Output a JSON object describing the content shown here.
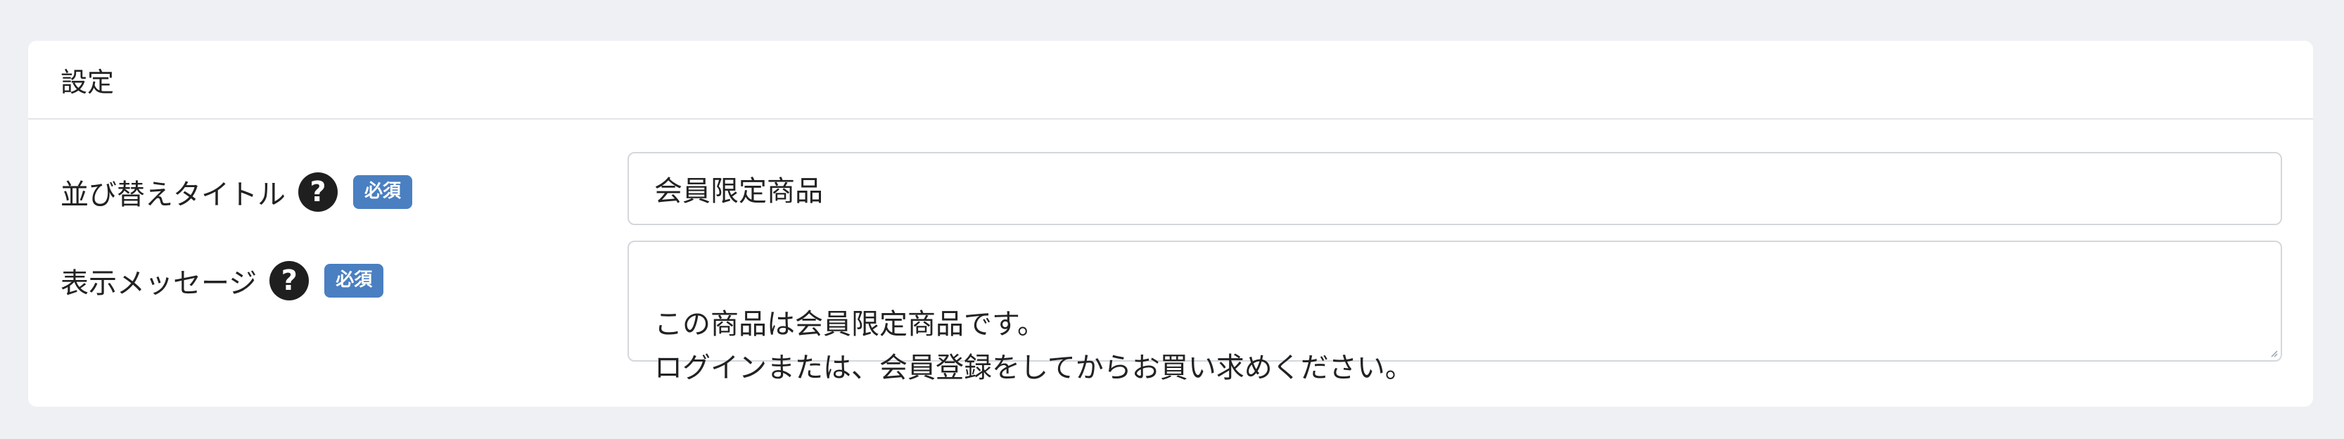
{
  "card": {
    "title": "設定"
  },
  "fields": {
    "sort_title": {
      "label": "並び替えタイトル",
      "help_icon": "question-circle-icon",
      "required_badge": "必須",
      "value": "会員限定商品"
    },
    "message": {
      "label": "表示メッセージ",
      "help_icon": "question-circle-icon",
      "required_badge": "必須",
      "value": "この商品は会員限定商品です。\nログインまたは、会員登録をしてからお買い求めください。"
    }
  },
  "colors": {
    "page_bg": "#eef0f4",
    "card_bg": "#ffffff",
    "badge_bg": "#4a7fc1",
    "help_icon_bg": "#1f1f1f",
    "input_border": "#d4d7dc"
  }
}
